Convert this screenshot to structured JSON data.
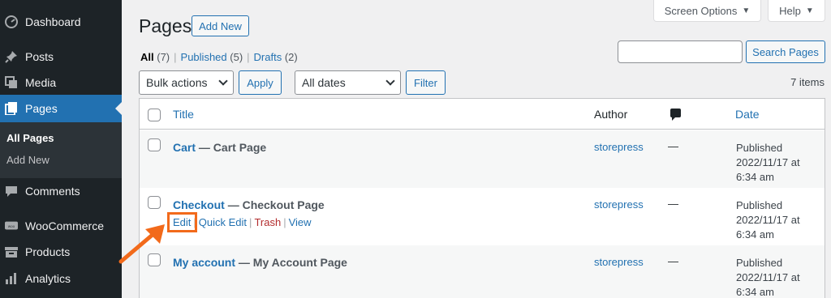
{
  "sidebar": {
    "items": [
      {
        "label": "Dashboard",
        "icon": "dashboard-icon"
      },
      {
        "label": "Posts",
        "icon": "pin-icon"
      },
      {
        "label": "Media",
        "icon": "media-icon"
      },
      {
        "label": "Pages",
        "icon": "pages-icon"
      },
      {
        "label": "Comments",
        "icon": "comment-icon"
      },
      {
        "label": "WooCommerce",
        "icon": "woo-icon"
      },
      {
        "label": "Products",
        "icon": "archive-icon"
      },
      {
        "label": "Analytics",
        "icon": "chart-bar-icon"
      }
    ],
    "submenu": [
      "All Pages",
      "Add New"
    ]
  },
  "header": {
    "screen_options": "Screen Options",
    "help": "Help",
    "title": "Pages",
    "add_new": "Add New"
  },
  "views": {
    "all": "All",
    "all_count": "(7)",
    "published": "Published",
    "published_count": "(5)",
    "drafts": "Drafts",
    "drafts_count": "(2)"
  },
  "search": {
    "button": "Search Pages",
    "value": ""
  },
  "tablenav": {
    "bulk_actions": "Bulk actions",
    "apply": "Apply",
    "all_dates": "All dates",
    "filter": "Filter",
    "items_count": "7 items"
  },
  "table": {
    "columns": {
      "title": "Title",
      "author": "Author",
      "date": "Date"
    },
    "rows": [
      {
        "title": "Cart",
        "state": "— Cart Page",
        "author": "storepress",
        "comments": "—",
        "date_status": "Published",
        "date_day": "2022/11/17 at",
        "date_time": "6:34 am"
      },
      {
        "title": "Checkout",
        "state": "— Checkout Page",
        "author": "storepress",
        "comments": "—",
        "date_status": "Published",
        "date_day": "2022/11/17 at",
        "date_time": "6:34 am"
      },
      {
        "title": "My account",
        "state": "— My Account Page",
        "author": "storepress",
        "comments": "—",
        "date_status": "Published",
        "date_day": "2022/11/17 at",
        "date_time": "6:34 am"
      }
    ],
    "row_actions": {
      "edit": "Edit",
      "quick_edit": "Quick Edit",
      "trash": "Trash",
      "view": "View"
    }
  },
  "colors": {
    "accent": "#2271b1",
    "sidebar": "#1d2327",
    "highlight": "#f26a1b",
    "trash": "#b32d2e"
  }
}
